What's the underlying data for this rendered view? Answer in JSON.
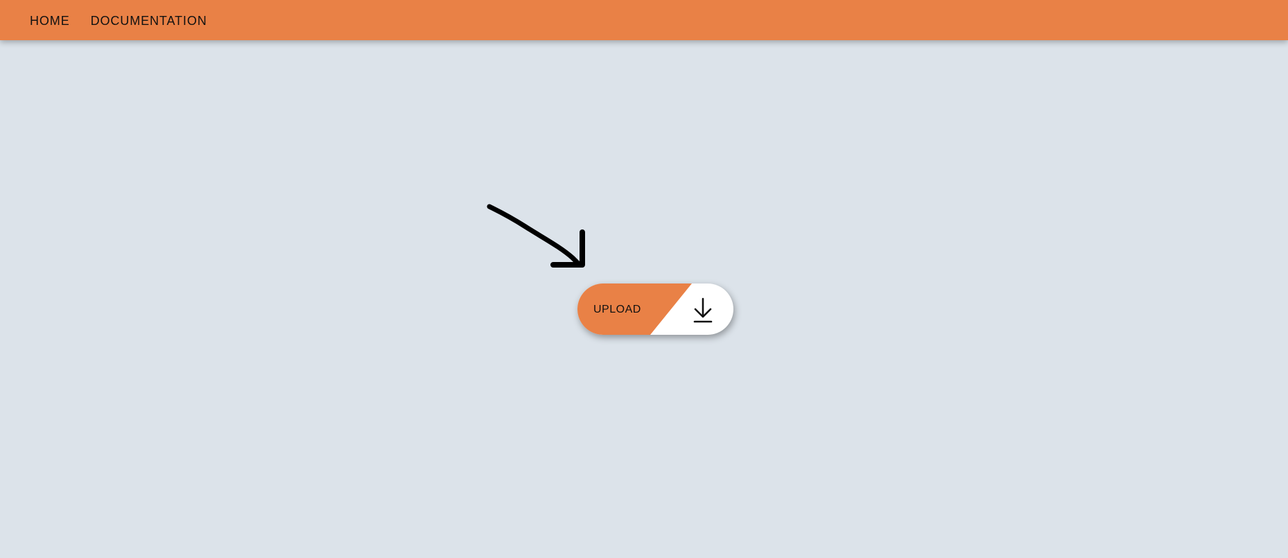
{
  "nav": {
    "items": [
      {
        "label": "HOME"
      },
      {
        "label": "DOCUMENTATION"
      }
    ]
  },
  "upload_button": {
    "label": "UPLOAD",
    "icon": "download-icon"
  },
  "annotation": {
    "icon": "hand-drawn-arrow"
  },
  "colors": {
    "accent": "#e98146",
    "background": "#dce3ea",
    "button_right": "#ffffff",
    "text": "#111111"
  }
}
